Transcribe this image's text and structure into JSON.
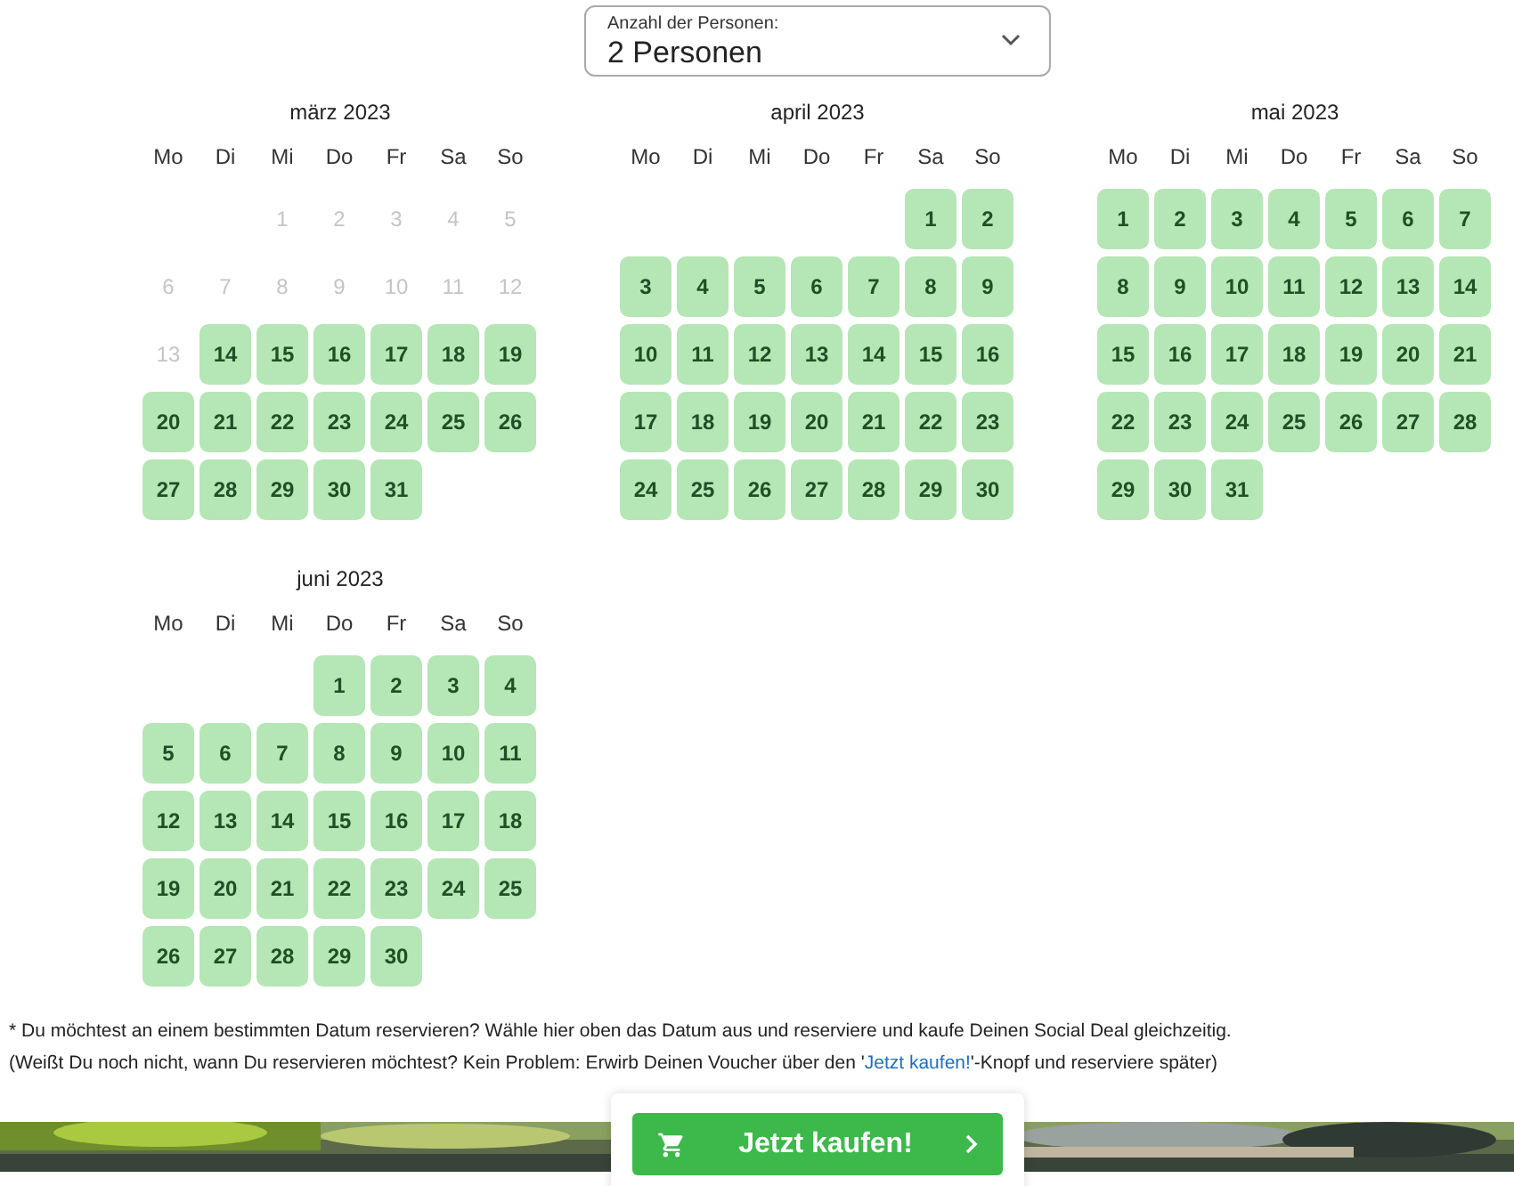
{
  "persons_select": {
    "label": "Anzahl der Personen:",
    "value": "2 Personen"
  },
  "months": [
    {
      "title": "märz 2023",
      "weekdays": [
        "Mo",
        "Di",
        "Mi",
        "Do",
        "Fr",
        "Sa",
        "So"
      ],
      "weeks": [
        {
          "right_aligned": true,
          "days": [
            {
              "day": "1",
              "available": false
            },
            {
              "day": "2",
              "available": false
            },
            {
              "day": "3",
              "available": false
            },
            {
              "day": "4",
              "available": false
            },
            {
              "day": "5",
              "available": false
            }
          ]
        },
        {
          "days": [
            {
              "day": "6",
              "available": false
            },
            {
              "day": "7",
              "available": false
            },
            {
              "day": "8",
              "available": false
            },
            {
              "day": "9",
              "available": false
            },
            {
              "day": "10",
              "available": false
            },
            {
              "day": "11",
              "available": false
            },
            {
              "day": "12",
              "available": false
            }
          ]
        },
        {
          "days": [
            {
              "day": "13",
              "available": false
            },
            {
              "day": "14",
              "available": true
            },
            {
              "day": "15",
              "available": true
            },
            {
              "day": "16",
              "available": true
            },
            {
              "day": "17",
              "available": true
            },
            {
              "day": "18",
              "available": true
            },
            {
              "day": "19",
              "available": true
            }
          ]
        },
        {
          "days": [
            {
              "day": "20",
              "available": true
            },
            {
              "day": "21",
              "available": true
            },
            {
              "day": "22",
              "available": true
            },
            {
              "day": "23",
              "available": true
            },
            {
              "day": "24",
              "available": true
            },
            {
              "day": "25",
              "available": true
            },
            {
              "day": "26",
              "available": true
            }
          ]
        },
        {
          "right_aligned": false,
          "days": [
            {
              "day": "27",
              "available": true
            },
            {
              "day": "28",
              "available": true
            },
            {
              "day": "29",
              "available": true
            },
            {
              "day": "30",
              "available": true
            },
            {
              "day": "31",
              "available": true
            }
          ]
        }
      ]
    },
    {
      "title": "april 2023",
      "weekdays": [
        "Mo",
        "Di",
        "Mi",
        "Do",
        "Fr",
        "Sa",
        "So"
      ],
      "weeks": [
        {
          "right_aligned": true,
          "days": [
            {
              "day": "1",
              "available": true
            },
            {
              "day": "2",
              "available": true
            }
          ]
        },
        {
          "days": [
            {
              "day": "3",
              "available": true
            },
            {
              "day": "4",
              "available": true
            },
            {
              "day": "5",
              "available": true
            },
            {
              "day": "6",
              "available": true
            },
            {
              "day": "7",
              "available": true
            },
            {
              "day": "8",
              "available": true
            },
            {
              "day": "9",
              "available": true
            }
          ]
        },
        {
          "days": [
            {
              "day": "10",
              "available": true
            },
            {
              "day": "11",
              "available": true
            },
            {
              "day": "12",
              "available": true
            },
            {
              "day": "13",
              "available": true
            },
            {
              "day": "14",
              "available": true
            },
            {
              "day": "15",
              "available": true
            },
            {
              "day": "16",
              "available": true
            }
          ]
        },
        {
          "days": [
            {
              "day": "17",
              "available": true
            },
            {
              "day": "18",
              "available": true
            },
            {
              "day": "19",
              "available": true
            },
            {
              "day": "20",
              "available": true
            },
            {
              "day": "21",
              "available": true
            },
            {
              "day": "22",
              "available": true
            },
            {
              "day": "23",
              "available": true
            }
          ]
        },
        {
          "days": [
            {
              "day": "24",
              "available": true
            },
            {
              "day": "25",
              "available": true
            },
            {
              "day": "26",
              "available": true
            },
            {
              "day": "27",
              "available": true
            },
            {
              "day": "28",
              "available": true
            },
            {
              "day": "29",
              "available": true
            },
            {
              "day": "30",
              "available": true
            }
          ]
        }
      ]
    },
    {
      "title": "mai 2023",
      "weekdays": [
        "Mo",
        "Di",
        "Mi",
        "Do",
        "Fr",
        "Sa",
        "So"
      ],
      "weeks": [
        {
          "days": [
            {
              "day": "1",
              "available": true
            },
            {
              "day": "2",
              "available": true
            },
            {
              "day": "3",
              "available": true
            },
            {
              "day": "4",
              "available": true
            },
            {
              "day": "5",
              "available": true
            },
            {
              "day": "6",
              "available": true
            },
            {
              "day": "7",
              "available": true
            }
          ]
        },
        {
          "days": [
            {
              "day": "8",
              "available": true
            },
            {
              "day": "9",
              "available": true
            },
            {
              "day": "10",
              "available": true
            },
            {
              "day": "11",
              "available": true
            },
            {
              "day": "12",
              "available": true
            },
            {
              "day": "13",
              "available": true
            },
            {
              "day": "14",
              "available": true
            }
          ]
        },
        {
          "days": [
            {
              "day": "15",
              "available": true
            },
            {
              "day": "16",
              "available": true
            },
            {
              "day": "17",
              "available": true
            },
            {
              "day": "18",
              "available": true
            },
            {
              "day": "19",
              "available": true
            },
            {
              "day": "20",
              "available": true
            },
            {
              "day": "21",
              "available": true
            }
          ]
        },
        {
          "days": [
            {
              "day": "22",
              "available": true
            },
            {
              "day": "23",
              "available": true
            },
            {
              "day": "24",
              "available": true
            },
            {
              "day": "25",
              "available": true
            },
            {
              "day": "26",
              "available": true
            },
            {
              "day": "27",
              "available": true
            },
            {
              "day": "28",
              "available": true
            }
          ]
        },
        {
          "right_aligned": false,
          "days": [
            {
              "day": "29",
              "available": true
            },
            {
              "day": "30",
              "available": true
            },
            {
              "day": "31",
              "available": true
            }
          ]
        }
      ]
    },
    {
      "title": "juni 2023",
      "weekdays": [
        "Mo",
        "Di",
        "Mi",
        "Do",
        "Fr",
        "Sa",
        "So"
      ],
      "weeks": [
        {
          "right_aligned": true,
          "days": [
            {
              "day": "1",
              "available": true
            },
            {
              "day": "2",
              "available": true
            },
            {
              "day": "3",
              "available": true
            },
            {
              "day": "4",
              "available": true
            }
          ]
        },
        {
          "days": [
            {
              "day": "5",
              "available": true
            },
            {
              "day": "6",
              "available": true
            },
            {
              "day": "7",
              "available": true
            },
            {
              "day": "8",
              "available": true
            },
            {
              "day": "9",
              "available": true
            },
            {
              "day": "10",
              "available": true
            },
            {
              "day": "11",
              "available": true
            }
          ]
        },
        {
          "days": [
            {
              "day": "12",
              "available": true
            },
            {
              "day": "13",
              "available": true
            },
            {
              "day": "14",
              "available": true
            },
            {
              "day": "15",
              "available": true
            },
            {
              "day": "16",
              "available": true
            },
            {
              "day": "17",
              "available": true
            },
            {
              "day": "18",
              "available": true
            }
          ]
        },
        {
          "days": [
            {
              "day": "19",
              "available": true
            },
            {
              "day": "20",
              "available": true
            },
            {
              "day": "21",
              "available": true
            },
            {
              "day": "22",
              "available": true
            },
            {
              "day": "23",
              "available": true
            },
            {
              "day": "24",
              "available": true
            },
            {
              "day": "25",
              "available": true
            }
          ]
        },
        {
          "right_aligned": false,
          "days": [
            {
              "day": "26",
              "available": true
            },
            {
              "day": "27",
              "available": true
            },
            {
              "day": "28",
              "available": true
            },
            {
              "day": "29",
              "available": true
            },
            {
              "day": "30",
              "available": true
            }
          ]
        }
      ]
    }
  ],
  "footnote": {
    "line_1": "* Du möchtest an einem bestimmten Datum reservieren? Wähle hier oben das Datum aus und reserviere und kaufe Deinen Social Deal gleichzeitig.",
    "line_2_before": "(Weißt Du noch nicht, wann Du reservieren möchtest? Kein Problem: Erwirb Deinen Voucher über den '",
    "line_2_link": "Jetzt kaufen!",
    "line_2_after": "'-Knopf und reserviere später)"
  },
  "buy_button": {
    "label": "Jetzt kaufen!"
  }
}
